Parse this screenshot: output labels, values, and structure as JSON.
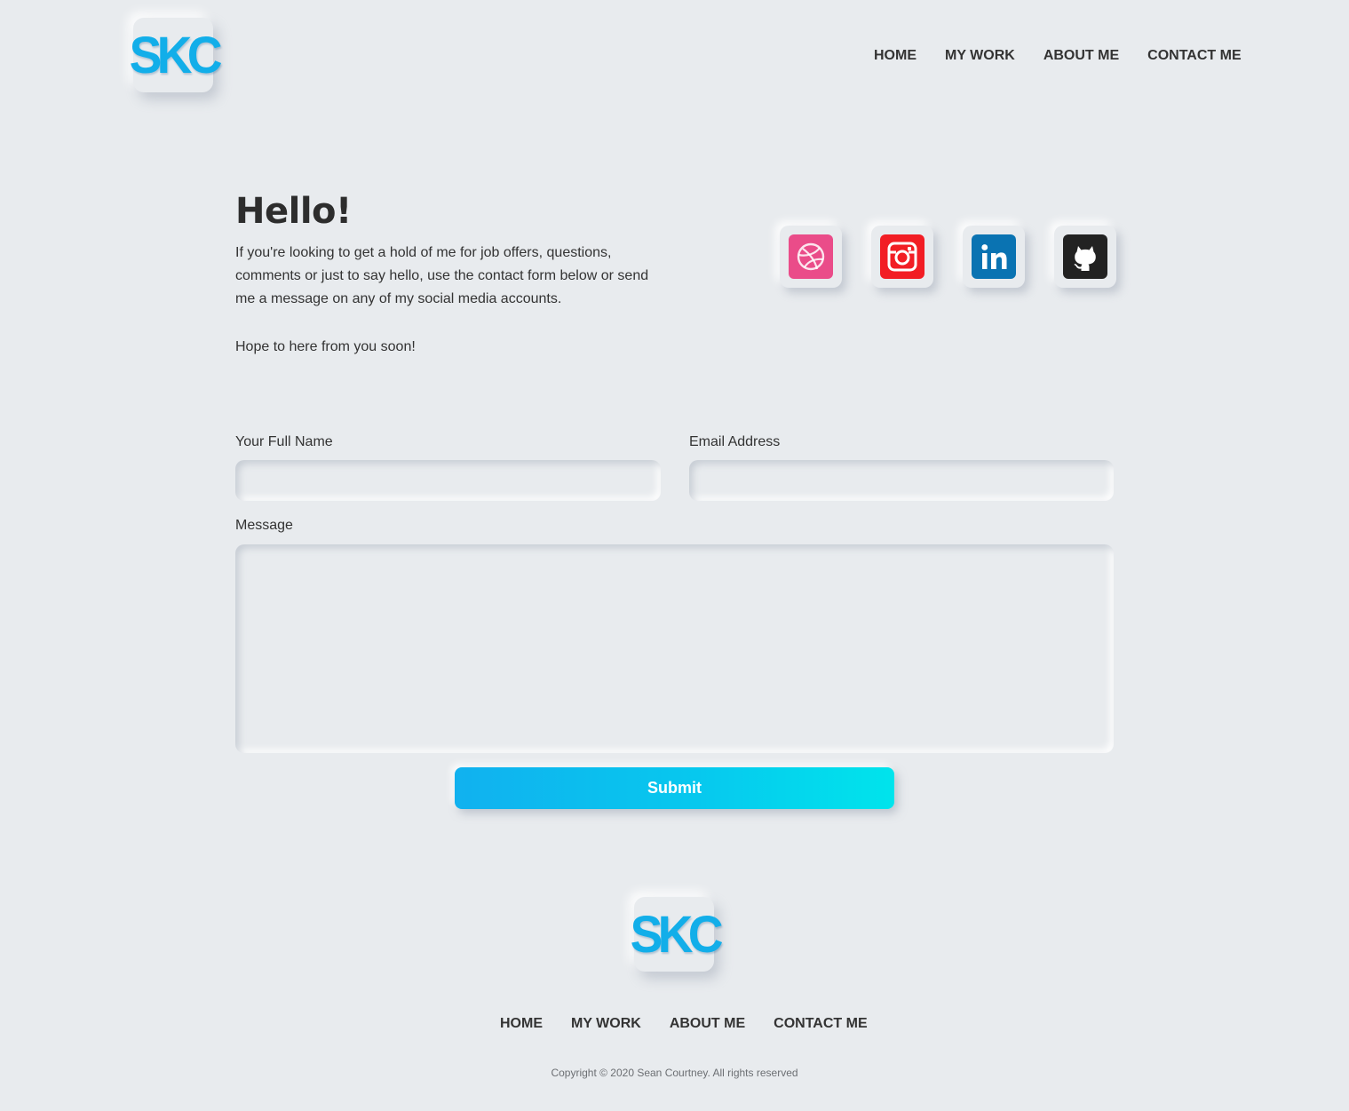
{
  "logo": {
    "text": "SKC",
    "color": "#12aee9"
  },
  "nav": {
    "items": [
      {
        "label": "HOME"
      },
      {
        "label": "MY WORK"
      },
      {
        "label": "ABOUT ME"
      },
      {
        "label": "CONTACT ME"
      }
    ]
  },
  "intro": {
    "heading": "Hello!",
    "paragraph": "If you're looking to get a hold of me for job offers, questions, comments or just to say hello, use the contact form below or send me a message on any of my social media accounts.",
    "closing": "Hope to here from you soon!"
  },
  "social": [
    {
      "name": "dribbble-icon",
      "color": "#ea4c89"
    },
    {
      "name": "instagram-icon",
      "color": "#f21d24"
    },
    {
      "name": "linkedin-icon",
      "color": "#0a73b2"
    },
    {
      "name": "github-icon",
      "color": "#222222"
    }
  ],
  "form": {
    "name_label": "Your Full Name",
    "name_value": "",
    "email_label": "Email Address",
    "email_value": "",
    "message_label": "Message",
    "message_value": "",
    "submit_label": "Submit"
  },
  "footer": {
    "copyright": "Copyright © 2020 Sean Courtney. All rights reserved"
  }
}
